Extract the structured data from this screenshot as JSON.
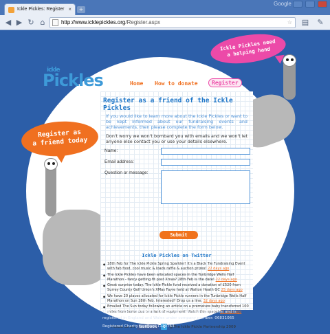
{
  "browser": {
    "tab_title": "Ickle Pickles: Register",
    "tab_close": "×",
    "new_tab": "+",
    "brand": "Google",
    "url_domain": "http://www.icklepickles.org",
    "url_path": "/Register.aspx",
    "icons": [
      "back-icon",
      "forward-icon",
      "reload-icon",
      "home-icon",
      "star-icon",
      "page-icon",
      "wrench-icon"
    ]
  },
  "site": {
    "logo_small": "ickle",
    "logo_big": "Pickles",
    "nav": {
      "home": "Home",
      "donate": "How to donate",
      "register": "Register"
    },
    "bubble_pink": [
      "Ickle Pickles need",
      "a helping hand"
    ],
    "bubble_orange": [
      "Register as",
      "a friend today"
    ]
  },
  "form": {
    "heading": "Register as a friend of the Ickle Pickles",
    "intro": "If you would like to learn more about the Ickle Pickles or want to be kept informed about our fundraising events and achievements, then please complete the form below.",
    "note": "Don't worry we won't bombard you with emails and we won't let anyone else contact you or use your details elsewhere.",
    "name_label": "Name:",
    "email_label": "Email address:",
    "question_label": "Question or message:",
    "submit": "Submit"
  },
  "twitter": {
    "title": "Ickle Pickles on Twitter",
    "tweets": [
      {
        "text": "18th Feb for The Ickle Pickle Spring Sparkler! It's a Black Tie Fundraising Event with fab food, cool music & loads raffle & auction prizes!",
        "ago": "22 days ago"
      },
      {
        "text": "The Ickle Pickles have been allocated spaces in the Tunbridge Wells Half Marathon - fancy getting fit post Xmas? 28th Feb is the date!",
        "ago": "22 days ago"
      },
      {
        "text": "Great surprise today. The Ickle Pickle fund received a donation of £520 from Surrey County Golf Union's XMas Fayre held at Walton Heath GC",
        "ago": "25 days ago"
      },
      {
        "text": "We have 20 places allocated for Ickle Pickle runners in the Tunbridge Wells Half Marathon on Sun 28th Feb. Interested? Drop us a line.",
        "ago": "32 days ago"
      },
      {
        "text": "Emailed The Sun today following an article on a premature baby transferred 100 miles from home due to a lack of equipment! Watch this space!",
        "ago": "51 days ago"
      }
    ],
    "follow": "Follow us on",
    "facebook": "facebook",
    "twitter_badge": "t",
    "copyright": "@The Ickle Pickle Partnership 2009"
  },
  "footer": {
    "line1": "The Ickle Pickle Partnership is a company limited by guarantee and is registered in England and Wales under company number: 06831065",
    "line2": "Registered Charity Number: 1129763"
  }
}
